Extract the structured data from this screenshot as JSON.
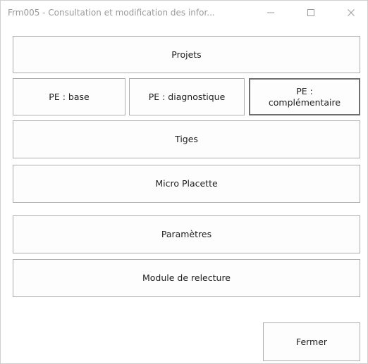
{
  "window": {
    "title": "Frm005 - Consultation et modification des infor...",
    "minimize_icon": "minimize-icon",
    "maximize_icon": "maximize-icon",
    "close_icon": "close-icon"
  },
  "buttons": {
    "projets": "Projets",
    "pe_base": "PE : base",
    "pe_diagnostique": "PE : diagnostique",
    "pe_complementaire_line1": "PE :",
    "pe_complementaire_line2": "complémentaire",
    "tiges": "Tiges",
    "micro_placette": "Micro Placette",
    "parametres": "Paramètres",
    "module_relecture": "Module de relecture",
    "fermer": "Fermer"
  }
}
